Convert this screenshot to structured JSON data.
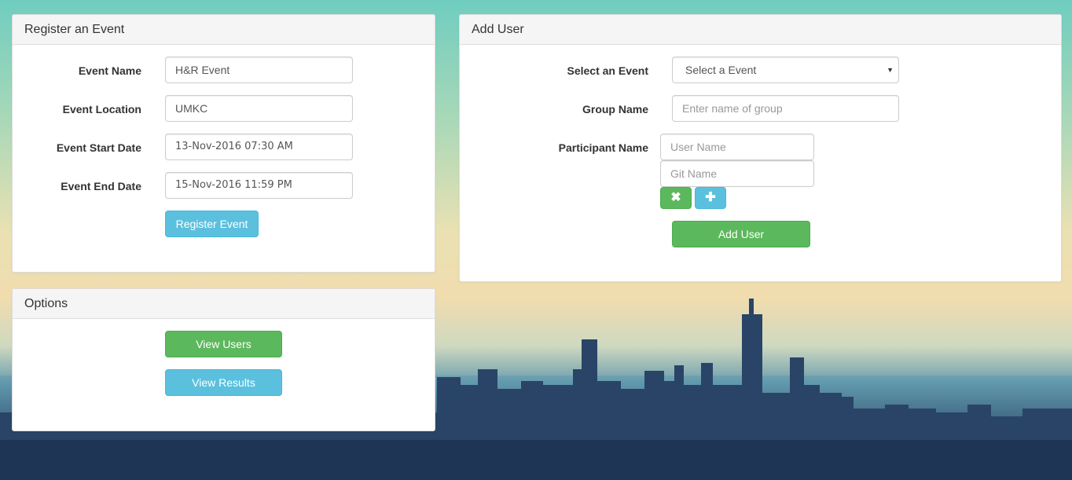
{
  "register_panel": {
    "title": "Register an Event",
    "event_name_label": "Event Name",
    "event_name_value": "H&R Event",
    "event_location_label": "Event Location",
    "event_location_value": "UMKC",
    "start_date_label": "Event Start Date",
    "start_date_value": "13-Nov-2016 07:30 AM",
    "end_date_label": "Event End Date",
    "end_date_value": "15-Nov-2016 11:59 PM",
    "register_button": "Register Event"
  },
  "options_panel": {
    "title": "Options",
    "view_users_button": "View Users",
    "view_results_button": "View Results"
  },
  "add_user_panel": {
    "title": "Add User",
    "select_event_label": "Select an Event",
    "select_event_value": "Select a Event",
    "group_name_label": "Group Name",
    "group_name_placeholder": "Enter name of group",
    "participant_label": "Participant Name",
    "user_name_placeholder": "User Name",
    "git_name_placeholder": "Git Name",
    "remove_icon": "✖",
    "add_icon": "✚",
    "add_user_button": "Add User"
  },
  "colors": {
    "info": "#5bc0de",
    "success": "#5cb85c"
  }
}
